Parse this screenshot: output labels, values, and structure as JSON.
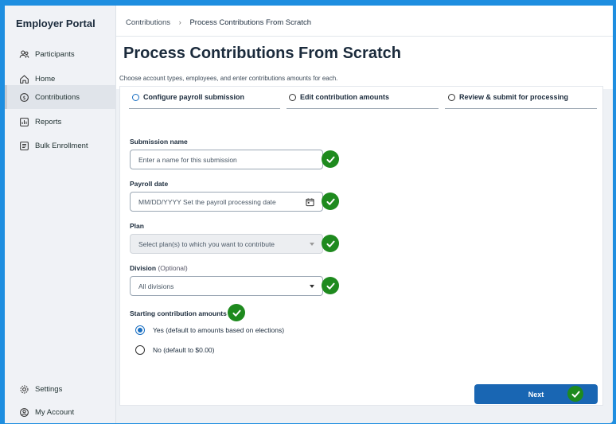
{
  "app": {
    "title": "Employer Portal"
  },
  "sidebar": {
    "items": [
      {
        "label": "Participants",
        "icon": "people-icon"
      },
      {
        "label": "Home",
        "icon": "home-icon"
      },
      {
        "label": "Contributions",
        "icon": "dollar-cycle-icon",
        "active": true
      },
      {
        "label": "Reports",
        "icon": "report-icon"
      },
      {
        "label": "Bulk Enrollment",
        "icon": "list-icon"
      }
    ],
    "footer": [
      {
        "label": "Settings",
        "icon": "gear-icon"
      },
      {
        "label": "My Account",
        "icon": "account-icon"
      }
    ]
  },
  "breadcrumb": {
    "parent": "Contributions",
    "separator": "›",
    "current": "Process Contributions From Scratch"
  },
  "page": {
    "title": "Process Contributions From Scratch",
    "subtitle": "Choose account types, employees, and enter contributions amounts for each."
  },
  "steps": [
    {
      "label": "Configure payroll submission",
      "active": true
    },
    {
      "label": "Edit contribution amounts",
      "active": false
    },
    {
      "label": "Review & submit for processing",
      "active": false
    }
  ],
  "form": {
    "submission_name": {
      "label": "Submission name",
      "placeholder": "Enter a name for this submission"
    },
    "payroll_date": {
      "label": "Payroll date",
      "placeholder": "MM/DD/YYYY Set the payroll processing date"
    },
    "plan": {
      "label": "Plan",
      "placeholder": "Select plan(s) to which you want to contribute"
    },
    "division": {
      "label": "Division",
      "optional": "(Optional)",
      "value": "All divisions"
    },
    "starting": {
      "label": "Starting contribution amounts",
      "options": [
        {
          "label": "Yes (default to amounts based on elections)",
          "selected": true
        },
        {
          "label": "No (default to $0.00)",
          "selected": false
        }
      ]
    }
  },
  "actions": {
    "next_label": "Next"
  },
  "colors": {
    "accent": "#1966b3",
    "check": "#1e8a1e",
    "background": "#1e8ee0"
  }
}
